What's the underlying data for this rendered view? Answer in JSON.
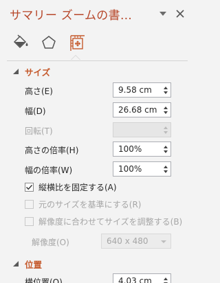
{
  "pane": {
    "title": "サマリー ズームの書…",
    "colors": {
      "title": "#b7472a",
      "section": "#c55a2d",
      "tab_icon_active": "#c55a2d"
    }
  },
  "tabs": [
    {
      "name": "fill-line",
      "icon": "paint-bucket-icon"
    },
    {
      "name": "effects",
      "icon": "pentagon-icon"
    },
    {
      "name": "size-properties",
      "icon": "size-position-icon",
      "active": true
    }
  ],
  "size_section": {
    "header": "サイズ",
    "height_label": "高さ(E)",
    "height_value": "9.58 cm",
    "width_label": "幅(D)",
    "width_value": "26.68 cm",
    "rotation_label": "回転(T)",
    "rotation_value": "",
    "scale_height_label": "高さの倍率(H)",
    "scale_height_value": "100%",
    "scale_width_label": "幅の倍率(W)",
    "scale_width_value": "100%",
    "lock_aspect_label": "縦横比を固定する(A)",
    "lock_aspect_checked": true,
    "relative_original_label": "元のサイズを基準にする(R)",
    "relative_original_checked": false,
    "best_scale_label": "解像度に合わせてサイズを調整する(B)",
    "best_scale_checked": false,
    "resolution_label": "解像度(O)",
    "resolution_value": "640 x 480"
  },
  "position_section": {
    "header": "位置",
    "horizontal_label": "横位置(O)",
    "horizontal_value": "4.03 cm"
  }
}
